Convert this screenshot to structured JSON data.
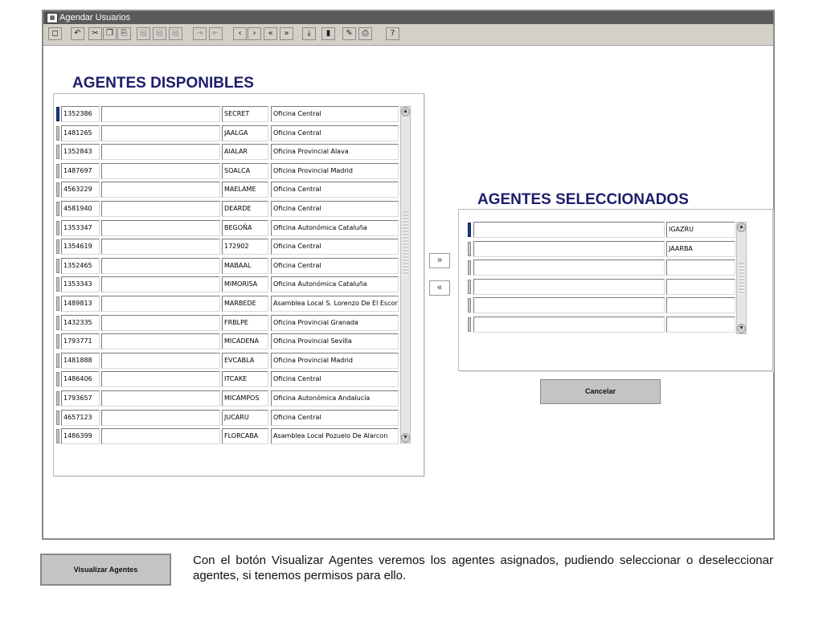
{
  "window": {
    "title": "Agendar Usuarios",
    "app_icon": "form-icon"
  },
  "toolbar": {
    "buttons": [
      {
        "name": "save-icon",
        "glyph": "◻"
      },
      {
        "name": "undo-icon",
        "glyph": "↶"
      },
      {
        "name": "cut-icon",
        "glyph": "✂"
      },
      {
        "name": "copy-icon",
        "glyph": "❐"
      },
      {
        "name": "paste-icon",
        "glyph": "⎘"
      },
      {
        "name": "insert-record-icon",
        "glyph": "▤"
      },
      {
        "name": "duplicate-record-icon",
        "glyph": "▤"
      },
      {
        "name": "delete-record-icon",
        "glyph": "▤"
      },
      {
        "name": "enter-query-icon",
        "glyph": "⇥"
      },
      {
        "name": "execute-query-icon",
        "glyph": "⇤"
      },
      {
        "name": "previous-record-icon",
        "glyph": "‹"
      },
      {
        "name": "next-record-icon",
        "glyph": "›"
      },
      {
        "name": "first-record-icon",
        "glyph": "«"
      },
      {
        "name": "last-record-icon",
        "glyph": "»"
      },
      {
        "name": "download-icon",
        "glyph": "⤓"
      },
      {
        "name": "exit-icon",
        "glyph": "▮"
      },
      {
        "name": "edit-icon",
        "glyph": "✎"
      },
      {
        "name": "print-icon",
        "glyph": "⎙"
      },
      {
        "name": "help-icon",
        "glyph": "?"
      }
    ]
  },
  "disponibles": {
    "title": "AGENTES DISPONIBLES",
    "rows": [
      {
        "id": "1352386",
        "name": "",
        "user": "SECRET",
        "office": "Oficina Central"
      },
      {
        "id": "1481265",
        "name": "",
        "user": "JAALGA",
        "office": "Oficina Central"
      },
      {
        "id": "1352843",
        "name": "",
        "user": "AIALAR",
        "office": "Oficina Provincial Alava"
      },
      {
        "id": "1487697",
        "name": "",
        "user": "SOALCA",
        "office": "Oficina Provincial Madrid"
      },
      {
        "id": "4563229",
        "name": "",
        "user": "MAELAME",
        "office": "Oficina Central"
      },
      {
        "id": "4581940",
        "name": "",
        "user": "DEARDE",
        "office": "Oficina Central"
      },
      {
        "id": "1353347",
        "name": "",
        "user": "BEGOÑA",
        "office": "Oficina Autonómica Cataluña"
      },
      {
        "id": "1354619",
        "name": "",
        "user": "172902",
        "office": "Oficina Central"
      },
      {
        "id": "1352465",
        "name": "",
        "user": "MABAAL",
        "office": "Oficina Central"
      },
      {
        "id": "1353343",
        "name": "",
        "user": "MIMORISA",
        "office": "Oficina Autonómica Cataluña"
      },
      {
        "id": "1489813",
        "name": "",
        "user": "MARBEDE",
        "office": "Asamblea Local S. Lorenzo De El Escorial"
      },
      {
        "id": "1432335",
        "name": "",
        "user": "FRBLPE",
        "office": "Oficina Provincial Granada"
      },
      {
        "id": "1793771",
        "name": "",
        "user": "MICADENA",
        "office": "Oficina Provincial Sevilla"
      },
      {
        "id": "1481888",
        "name": "",
        "user": "EVCABLA",
        "office": "Oficina Provincial Madrid"
      },
      {
        "id": "1486406",
        "name": "",
        "user": "ITCAKE",
        "office": "Oficina Central"
      },
      {
        "id": "1793657",
        "name": "",
        "user": "MICAMPOS",
        "office": "Oficina Autonómica Andalucía"
      },
      {
        "id": "4657123",
        "name": "",
        "user": "JUCARU",
        "office": "Oficina Central"
      },
      {
        "id": "1486399",
        "name": "",
        "user": "FLORCABA",
        "office": "Asamblea Local Pozuelo De Alarcon"
      }
    ]
  },
  "seleccionados": {
    "title": "AGENTES SELECCIONADOS",
    "rows": [
      {
        "name": "",
        "user": "IGAZRU"
      },
      {
        "name": "",
        "user": "JAARBA"
      },
      {
        "name": "",
        "user": ""
      },
      {
        "name": "",
        "user": ""
      },
      {
        "name": "",
        "user": ""
      },
      {
        "name": "",
        "user": ""
      }
    ]
  },
  "move": {
    "add_glyph": "»",
    "remove_glyph": "«"
  },
  "scroll": {
    "up_glyph": "▲",
    "down_glyph": "▼"
  },
  "buttons": {
    "cancelar": "Cancelar",
    "visualizar": "Visualizar Agentes"
  },
  "caption": "Con el botón Visualizar Agentes veremos los agentes asignados, pudiendo seleccionar o deseleccionar agentes, si tenemos permisos para ello."
}
